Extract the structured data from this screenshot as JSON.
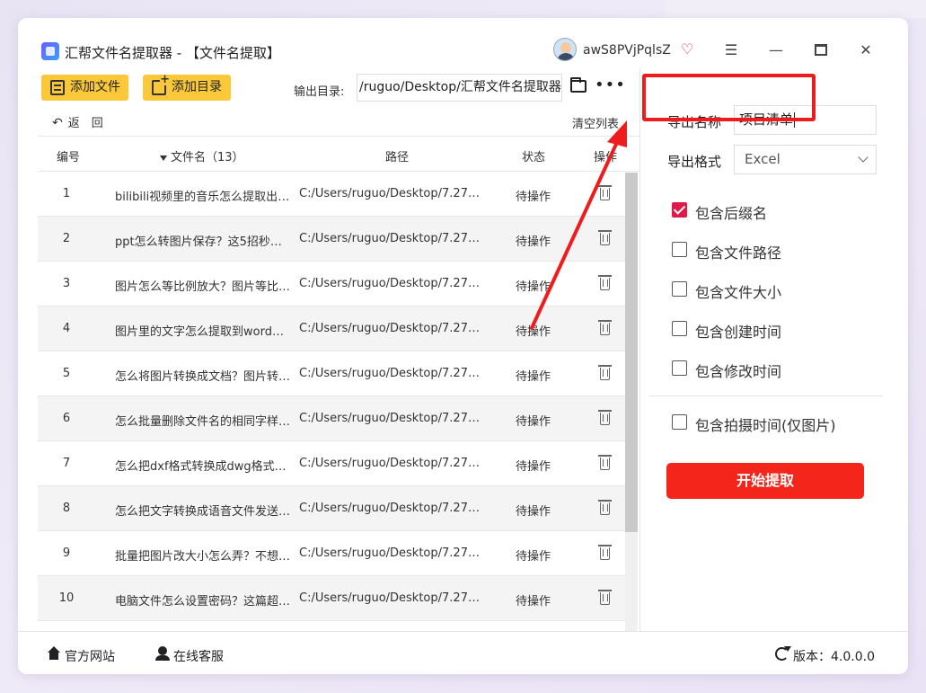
{
  "window": {
    "title": "汇帮文件名提取器 - 【文件名提取】",
    "user_name": "awS8PVjPqlsZ"
  },
  "toolbar": {
    "add_file_label": "添加文件",
    "add_dir_label": "添加目录",
    "output_label": "输出目录:",
    "output_path": "/ruguo/Desktop/汇帮文件名提取器",
    "more_label": "•••",
    "back_label": "返　回",
    "clear_label": "清空列表"
  },
  "table": {
    "headers": {
      "no": "编号",
      "name": "文件名（13）",
      "path": "路径",
      "status": "状态",
      "op": "操作"
    },
    "rows": [
      {
        "no": "1",
        "name": "bilibili视频里的音乐怎么提取出来...",
        "path": "C:/Users/ruguo/Desktop/7.27/b...",
        "status": "待操作"
      },
      {
        "no": "2",
        "name": "ppt怎么转图片保存？这5招秒变高...",
        "path": "C:/Users/ruguo/Desktop/7.27/p...",
        "status": "待操作"
      },
      {
        "no": "3",
        "name": "图片怎么等比例放大？图片等比例...",
        "path": "C:/Users/ruguo/Desktop/7.27/...",
        "status": "待操作"
      },
      {
        "no": "4",
        "name": "图片里的文字怎么提取到word？5...",
        "path": "C:/Users/ruguo/Desktop/7.27/...",
        "status": "待操作"
      },
      {
        "no": "5",
        "name": "怎么将图片转换成文档？图片转文...",
        "path": "C:/Users/ruguo/Desktop/7.27/...",
        "status": "待操作"
      },
      {
        "no": "6",
        "name": "怎么批量删除文件名的相同字样？...",
        "path": "C:/Users/ruguo/Desktop/7.27/...",
        "status": "待操作"
      },
      {
        "no": "7",
        "name": "怎么把dxf格式转换成dwg格式？...",
        "path": "C:/Users/ruguo/Desktop/7.27/...",
        "status": "待操作"
      },
      {
        "no": "8",
        "name": "怎么把文字转换成语音文件发送？...",
        "path": "C:/Users/ruguo/Desktop/7.27/...",
        "status": "待操作"
      },
      {
        "no": "9",
        "name": "批量把图片改大小怎么弄？不想一...",
        "path": "C:/Users/ruguo/Desktop/7.27/...",
        "status": "待操作"
      },
      {
        "no": "10",
        "name": "电脑文件怎么设置密码？这篇超全...",
        "path": "C:/Users/ruguo/Desktop/7.27/...",
        "status": "待操作"
      }
    ]
  },
  "settings": {
    "export_name_label": "导出名称",
    "export_name_value": "项目清单",
    "export_format_label": "导出格式",
    "export_format_value": "Excel",
    "options": [
      {
        "label": "包含后缀名",
        "checked": true
      },
      {
        "label": "包含文件路径",
        "checked": false
      },
      {
        "label": "包含文件大小",
        "checked": false
      },
      {
        "label": "包含创建时间",
        "checked": false
      },
      {
        "label": "包含修改时间",
        "checked": false
      },
      {
        "label": "包含拍摄时间(仅图片)",
        "checked": false
      }
    ],
    "start_label": "开始提取"
  },
  "footer": {
    "website_label": "官方网站",
    "service_label": "在线客服",
    "version_label": "版本：4.0.0.0"
  },
  "colors": {
    "accent_yellow": "#fbc83a",
    "start_red": "#f4261c",
    "check_red": "#e0194a",
    "annotation_red": "#ee1c1c"
  }
}
